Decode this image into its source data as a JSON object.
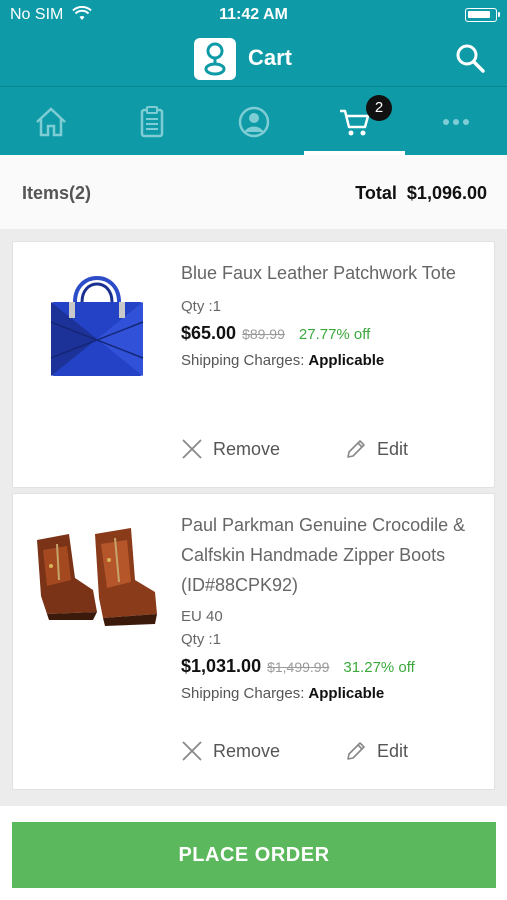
{
  "status_bar": {
    "carrier": "No SIM",
    "time": "11:42 AM"
  },
  "app_bar": {
    "title": "Cart"
  },
  "tabs": [
    {
      "name": "home",
      "icon": "home-icon"
    },
    {
      "name": "orders",
      "icon": "clipboard-icon"
    },
    {
      "name": "account",
      "icon": "user-icon"
    },
    {
      "name": "cart",
      "icon": "cart-icon",
      "badge": "2",
      "active": true
    },
    {
      "name": "more",
      "icon": "more-icon"
    }
  ],
  "summary": {
    "items_label": "Items",
    "items_count": "(2)",
    "total_label": "Total",
    "total_value": "$1,096.00"
  },
  "cart_items": [
    {
      "name": "Blue Faux Leather Patchwork Tote",
      "qty": "Qty :1",
      "price": "$65.00",
      "mrp": "$89.99",
      "discount": "27.77% off",
      "shipping_label": "Shipping Charges:",
      "shipping_value": "Applicable",
      "remove_label": "Remove",
      "edit_label": "Edit"
    },
    {
      "name": "Paul Parkman Genuine Crocodile & Calfskin Handmade Zipper Boots (ID#88CPK92)",
      "size": "EU 40",
      "qty": "Qty :1",
      "price": "$1,031.00",
      "mrp": "$1,499.99",
      "discount": "31.27% off",
      "shipping_label": "Shipping Charges:",
      "shipping_value": "Applicable",
      "remove_label": "Remove",
      "edit_label": "Edit"
    }
  ],
  "place_order_label": "PLACE ORDER",
  "colors": {
    "teal": "#0e9aa7",
    "green": "#5cb85c",
    "discount_green": "#3ca93c"
  }
}
